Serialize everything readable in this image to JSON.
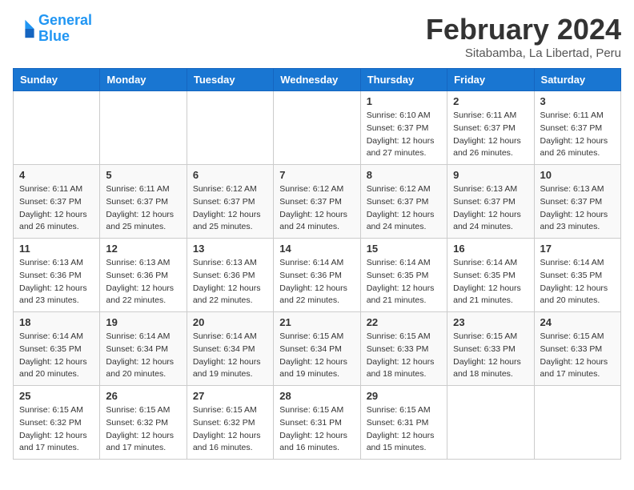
{
  "logo": {
    "line1": "General",
    "line2": "Blue"
  },
  "title": {
    "month_year": "February 2024",
    "location": "Sitabamba, La Libertad, Peru"
  },
  "headers": [
    "Sunday",
    "Monday",
    "Tuesday",
    "Wednesday",
    "Thursday",
    "Friday",
    "Saturday"
  ],
  "weeks": [
    [
      {
        "day": "",
        "info": ""
      },
      {
        "day": "",
        "info": ""
      },
      {
        "day": "",
        "info": ""
      },
      {
        "day": "",
        "info": ""
      },
      {
        "day": "1",
        "info": "Sunrise: 6:10 AM\nSunset: 6:37 PM\nDaylight: 12 hours\nand 27 minutes."
      },
      {
        "day": "2",
        "info": "Sunrise: 6:11 AM\nSunset: 6:37 PM\nDaylight: 12 hours\nand 26 minutes."
      },
      {
        "day": "3",
        "info": "Sunrise: 6:11 AM\nSunset: 6:37 PM\nDaylight: 12 hours\nand 26 minutes."
      }
    ],
    [
      {
        "day": "4",
        "info": "Sunrise: 6:11 AM\nSunset: 6:37 PM\nDaylight: 12 hours\nand 26 minutes."
      },
      {
        "day": "5",
        "info": "Sunrise: 6:11 AM\nSunset: 6:37 PM\nDaylight: 12 hours\nand 25 minutes."
      },
      {
        "day": "6",
        "info": "Sunrise: 6:12 AM\nSunset: 6:37 PM\nDaylight: 12 hours\nand 25 minutes."
      },
      {
        "day": "7",
        "info": "Sunrise: 6:12 AM\nSunset: 6:37 PM\nDaylight: 12 hours\nand 24 minutes."
      },
      {
        "day": "8",
        "info": "Sunrise: 6:12 AM\nSunset: 6:37 PM\nDaylight: 12 hours\nand 24 minutes."
      },
      {
        "day": "9",
        "info": "Sunrise: 6:13 AM\nSunset: 6:37 PM\nDaylight: 12 hours\nand 24 minutes."
      },
      {
        "day": "10",
        "info": "Sunrise: 6:13 AM\nSunset: 6:37 PM\nDaylight: 12 hours\nand 23 minutes."
      }
    ],
    [
      {
        "day": "11",
        "info": "Sunrise: 6:13 AM\nSunset: 6:36 PM\nDaylight: 12 hours\nand 23 minutes."
      },
      {
        "day": "12",
        "info": "Sunrise: 6:13 AM\nSunset: 6:36 PM\nDaylight: 12 hours\nand 22 minutes."
      },
      {
        "day": "13",
        "info": "Sunrise: 6:13 AM\nSunset: 6:36 PM\nDaylight: 12 hours\nand 22 minutes."
      },
      {
        "day": "14",
        "info": "Sunrise: 6:14 AM\nSunset: 6:36 PM\nDaylight: 12 hours\nand 22 minutes."
      },
      {
        "day": "15",
        "info": "Sunrise: 6:14 AM\nSunset: 6:35 PM\nDaylight: 12 hours\nand 21 minutes."
      },
      {
        "day": "16",
        "info": "Sunrise: 6:14 AM\nSunset: 6:35 PM\nDaylight: 12 hours\nand 21 minutes."
      },
      {
        "day": "17",
        "info": "Sunrise: 6:14 AM\nSunset: 6:35 PM\nDaylight: 12 hours\nand 20 minutes."
      }
    ],
    [
      {
        "day": "18",
        "info": "Sunrise: 6:14 AM\nSunset: 6:35 PM\nDaylight: 12 hours\nand 20 minutes."
      },
      {
        "day": "19",
        "info": "Sunrise: 6:14 AM\nSunset: 6:34 PM\nDaylight: 12 hours\nand 20 minutes."
      },
      {
        "day": "20",
        "info": "Sunrise: 6:14 AM\nSunset: 6:34 PM\nDaylight: 12 hours\nand 19 minutes."
      },
      {
        "day": "21",
        "info": "Sunrise: 6:15 AM\nSunset: 6:34 PM\nDaylight: 12 hours\nand 19 minutes."
      },
      {
        "day": "22",
        "info": "Sunrise: 6:15 AM\nSunset: 6:33 PM\nDaylight: 12 hours\nand 18 minutes."
      },
      {
        "day": "23",
        "info": "Sunrise: 6:15 AM\nSunset: 6:33 PM\nDaylight: 12 hours\nand 18 minutes."
      },
      {
        "day": "24",
        "info": "Sunrise: 6:15 AM\nSunset: 6:33 PM\nDaylight: 12 hours\nand 17 minutes."
      }
    ],
    [
      {
        "day": "25",
        "info": "Sunrise: 6:15 AM\nSunset: 6:32 PM\nDaylight: 12 hours\nand 17 minutes."
      },
      {
        "day": "26",
        "info": "Sunrise: 6:15 AM\nSunset: 6:32 PM\nDaylight: 12 hours\nand 17 minutes."
      },
      {
        "day": "27",
        "info": "Sunrise: 6:15 AM\nSunset: 6:32 PM\nDaylight: 12 hours\nand 16 minutes."
      },
      {
        "day": "28",
        "info": "Sunrise: 6:15 AM\nSunset: 6:31 PM\nDaylight: 12 hours\nand 16 minutes."
      },
      {
        "day": "29",
        "info": "Sunrise: 6:15 AM\nSunset: 6:31 PM\nDaylight: 12 hours\nand 15 minutes."
      },
      {
        "day": "",
        "info": ""
      },
      {
        "day": "",
        "info": ""
      }
    ]
  ]
}
